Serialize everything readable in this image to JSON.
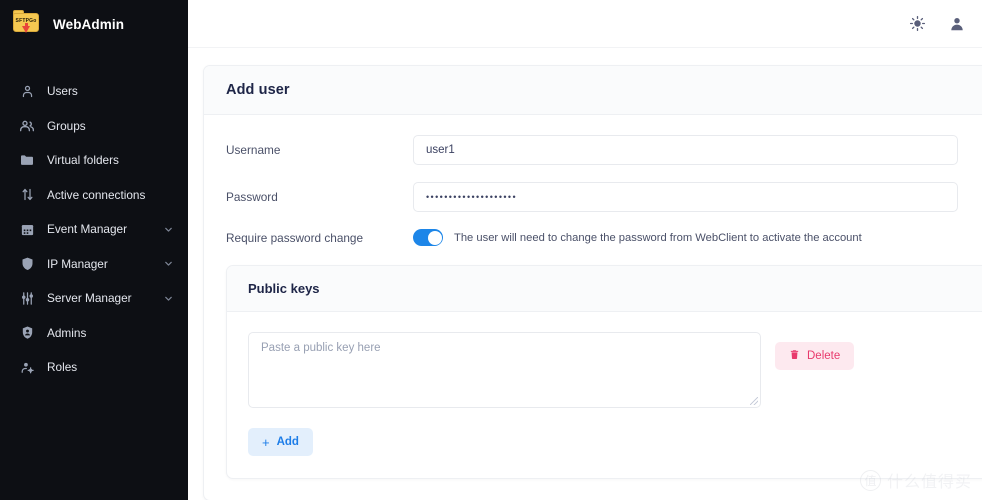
{
  "brand": {
    "name": "WebAdmin",
    "logo_text": "SFTPGo"
  },
  "sidebar": {
    "items": [
      {
        "label": "Users",
        "icon": "user-icon",
        "expandable": false
      },
      {
        "label": "Groups",
        "icon": "users-group-icon",
        "expandable": false
      },
      {
        "label": "Virtual folders",
        "icon": "folder-icon",
        "expandable": false
      },
      {
        "label": "Active connections",
        "icon": "arrows-updown-icon",
        "expandable": false
      },
      {
        "label": "Event Manager",
        "icon": "calendar-icon",
        "expandable": true
      },
      {
        "label": "IP Manager",
        "icon": "shield-icon",
        "expandable": true
      },
      {
        "label": "Server Manager",
        "icon": "sliders-icon",
        "expandable": true
      },
      {
        "label": "Admins",
        "icon": "badge-user-icon",
        "expandable": false
      },
      {
        "label": "Roles",
        "icon": "user-settings-icon",
        "expandable": false
      }
    ]
  },
  "topbar": {
    "theme_icon": "sun-icon",
    "account_icon": "account-icon"
  },
  "main": {
    "card_title": "Add user",
    "fields": {
      "username_label": "Username",
      "username_value": "user1",
      "password_label": "Password",
      "password_value": "••••••••••••••••••••",
      "require_change_label": "Require password change",
      "require_change_on": true,
      "require_change_help": "The user will need to change the password from WebClient to activate the account"
    },
    "public_keys": {
      "title": "Public keys",
      "textarea_placeholder": "Paste a public key here",
      "textarea_value": "",
      "delete_label": "Delete",
      "delete_icon": "trash-icon",
      "add_label": "Add",
      "add_icon": "plus-icon"
    }
  },
  "watermark": {
    "mark": "值",
    "text": "什么值得买"
  },
  "colors": {
    "sidebar_bg": "#0d0f14",
    "accent_blue": "#1d86e8",
    "delete_pink": "#e8396c",
    "logo_yellow": "#f5c851"
  }
}
